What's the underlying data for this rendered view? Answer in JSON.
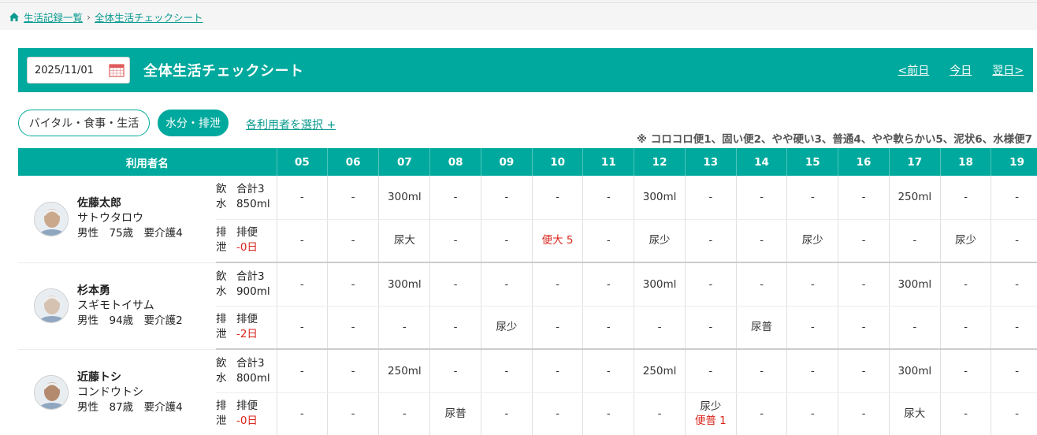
{
  "breadcrumb": {
    "home": "生活記録一覧",
    "sep": "›",
    "current": "全体生活チェックシート"
  },
  "header": {
    "date": "2025/11/01",
    "title": "全体生活チェックシート",
    "prev": "<前日",
    "today": "今日",
    "next": "翌日>"
  },
  "tabs": {
    "vital": "バイタル・食事・生活",
    "water": "水分・排泄",
    "select_user": "各利用者を選択 +"
  },
  "note": "※ コロコロ便1、固い便2、やや硬い3、普通4、やや軟らかい5、泥状6、水様便7",
  "table": {
    "user_header": "利用者名",
    "hours": [
      "05",
      "06",
      "07",
      "08",
      "09",
      "10",
      "11",
      "12",
      "13",
      "14",
      "15",
      "16",
      "17",
      "18",
      "19"
    ],
    "users": [
      {
        "name": "佐藤太郎",
        "kana": "サトウタロウ",
        "meta": "男性　75歳　要介護4",
        "water": {
          "k1": "飲",
          "v1": "合計3",
          "k2": "水",
          "v2": "850ml"
        },
        "excr": {
          "k1": "排",
          "v1": "排便",
          "k2": "泄",
          "v2": "-0日"
        },
        "water_cells": [
          "-",
          "-",
          "300ml",
          "-",
          "-",
          "-",
          "-",
          "300ml",
          "-",
          "-",
          "-",
          "-",
          "250ml",
          "-",
          "-"
        ],
        "excr_cells": [
          [
            "-"
          ],
          [
            "-"
          ],
          [
            "尿大"
          ],
          [
            "-"
          ],
          [
            "-"
          ],
          [
            "便大 5"
          ],
          [
            "-"
          ],
          [
            "尿少"
          ],
          [
            "-"
          ],
          [
            "-"
          ],
          [
            "尿少"
          ],
          [
            "-"
          ],
          [
            "-"
          ],
          [
            "尿少"
          ],
          [
            "-"
          ]
        ]
      },
      {
        "name": "杉本勇",
        "kana": "スギモトイサム",
        "meta": "男性　94歳　要介護2",
        "water": {
          "k1": "飲",
          "v1": "合計3",
          "k2": "水",
          "v2": "900ml"
        },
        "excr": {
          "k1": "排",
          "v1": "排便",
          "k2": "泄",
          "v2": "-2日"
        },
        "water_cells": [
          "-",
          "-",
          "300ml",
          "-",
          "-",
          "-",
          "-",
          "300ml",
          "-",
          "-",
          "-",
          "-",
          "300ml",
          "-",
          "-"
        ],
        "excr_cells": [
          [
            "-"
          ],
          [
            "-"
          ],
          [
            "-"
          ],
          [
            "-"
          ],
          [
            "尿少"
          ],
          [
            "-"
          ],
          [
            "-"
          ],
          [
            "-"
          ],
          [
            "-"
          ],
          [
            "尿普"
          ],
          [
            "-"
          ],
          [
            "-"
          ],
          [
            "-"
          ],
          [
            "-"
          ],
          [
            "-"
          ]
        ]
      },
      {
        "name": "近藤トシ",
        "kana": "コンドウトシ",
        "meta": "男性　87歳　要介護4",
        "water": {
          "k1": "飲",
          "v1": "合計3",
          "k2": "水",
          "v2": "800ml"
        },
        "excr": {
          "k1": "排",
          "v1": "排便",
          "k2": "泄",
          "v2": "-0日"
        },
        "water_cells": [
          "-",
          "-",
          "250ml",
          "-",
          "-",
          "-",
          "-",
          "250ml",
          "-",
          "-",
          "-",
          "-",
          "300ml",
          "-",
          "-"
        ],
        "excr_cells": [
          [
            "-"
          ],
          [
            "-"
          ],
          [
            "-"
          ],
          [
            "尿普"
          ],
          [
            "-"
          ],
          [
            "-"
          ],
          [
            "-"
          ],
          [
            "-"
          ],
          [
            "尿少",
            "便普 1"
          ],
          [
            "-"
          ],
          [
            "-"
          ],
          [
            "-"
          ],
          [
            "尿大"
          ],
          [
            "-"
          ],
          [
            "-"
          ]
        ]
      }
    ]
  },
  "colors": {
    "accent": "#00a99d",
    "link": "#0a9a8f",
    "alert": "#d9251c"
  },
  "icons": {
    "home": "home-icon",
    "calendar": "calendar-icon",
    "avatar": "avatar-photo"
  }
}
